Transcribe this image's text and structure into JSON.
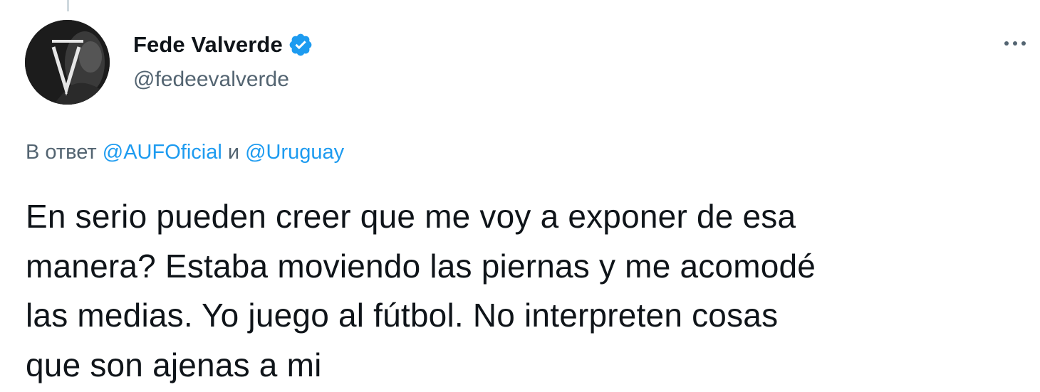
{
  "author": {
    "display_name": "Fede Valverde",
    "handle": "@fedeevalverde",
    "verified": true,
    "verified_icon": "verified-badge-icon",
    "avatar_monogram": "V"
  },
  "more_menu": {
    "icon": "more-horizontal-icon",
    "label": "···"
  },
  "reply_context": {
    "prefix": "В ответ",
    "mention_1": "@AUFOficial",
    "conjunction": "и",
    "mention_2": "@Uruguay"
  },
  "tweet": {
    "lines": [
      "En serio pueden creer que me voy a exponer de esa",
      "manera? Estaba moviendo las piernas y me acomodé",
      "las medias. Yo juego al fútbol. No interpreten cosas",
      "que son ajenas a mi"
    ]
  },
  "colors": {
    "accent": "#1d9bf0",
    "text_primary": "#0f1419",
    "text_secondary": "#536471",
    "thread_line": "#cfd9de"
  }
}
